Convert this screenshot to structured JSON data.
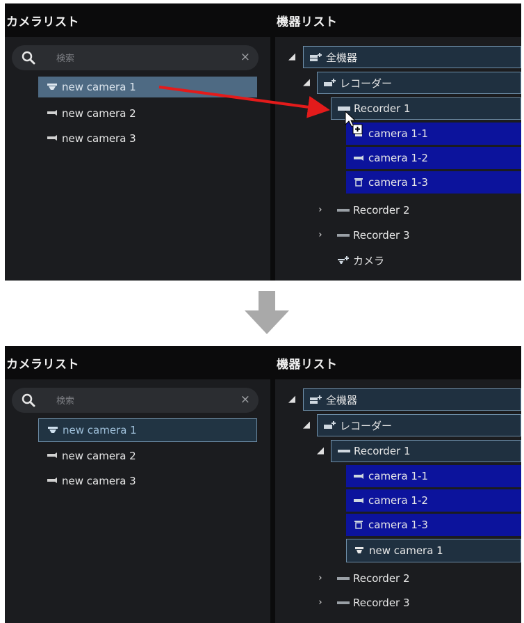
{
  "camera_list_title": "カメラリスト",
  "device_list_title": "機器リスト",
  "search": {
    "placeholder": "検索",
    "clear": "×"
  },
  "before": {
    "cameras": [
      "new camera 1",
      "new camera 2",
      "new camera 3"
    ],
    "tree": {
      "root": "全機器",
      "recorder_group": "レコーダー",
      "recorder1": "Recorder 1",
      "recorder1_children": [
        "camera 1-1",
        "camera 1-2",
        "camera 1-3"
      ],
      "recorder2": "Recorder 2",
      "recorder3": "Recorder 3",
      "camera_group": "カメラ"
    }
  },
  "after": {
    "cameras": [
      "new camera 1",
      "new camera 2",
      "new camera 3"
    ],
    "tree": {
      "root": "全機器",
      "recorder_group": "レコーダー",
      "recorder1": "Recorder 1",
      "recorder1_children": [
        "camera 1-1",
        "camera 1-2",
        "camera 1-3",
        "new camera 1"
      ],
      "recorder2": "Recorder 2",
      "recorder3": "Recorder 3"
    }
  },
  "colors": {
    "panel_bg": "#1b1c1f",
    "selection_blue": "#0c139c",
    "selected_item": "#4e6a83",
    "drag_arrow": "#e31b1b",
    "transition_arrow": "#a9a9a9"
  }
}
